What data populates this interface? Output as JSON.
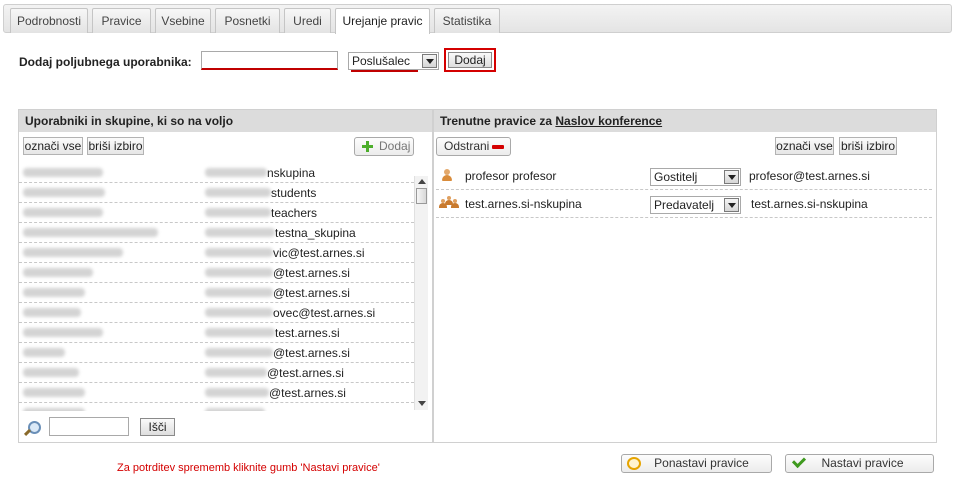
{
  "tabs": [
    "Podrobnosti",
    "Pravice",
    "Vsebine",
    "Posnetki",
    "Uredi",
    "Urejanje pravic",
    "Statistika"
  ],
  "active_tab": "Urejanje pravic",
  "add_user": {
    "label": "Dodaj poljubnega uporabnika:",
    "input_value": "",
    "role_value": "Poslušalec",
    "button_label": "Dodaj"
  },
  "available": {
    "title": "Uporabniki in skupine, ki so na voljo",
    "select_all_label": "označi vse",
    "clear_label": "briši izbiro",
    "add_label": "Dodaj",
    "rows": [
      {
        "tail": "nskupina"
      },
      {
        "tail": "students"
      },
      {
        "tail": "teachers"
      },
      {
        "tail": "testna_skupina"
      },
      {
        "tail": "vic@test.arnes.si"
      },
      {
        "tail": "@test.arnes.si"
      },
      {
        "tail": "@test.arnes.si"
      },
      {
        "tail": "ovec@test.arnes.si"
      },
      {
        "tail": "test.arnes.si"
      },
      {
        "tail": "@test.arnes.si"
      },
      {
        "tail": "@test.arnes.si"
      },
      {
        "tail": "@test.arnes.si"
      },
      {
        "tail": ""
      }
    ],
    "search_value": "",
    "search_button": "Išči"
  },
  "current": {
    "title_prefix": "Trenutne pravice za",
    "title_link": "Naslov konference",
    "remove_label": "Odstrani",
    "select_all_label": "označi vse",
    "clear_label": "briši izbiro",
    "rows": [
      {
        "icon": "person-icon",
        "name": "profesor profesor",
        "role": "Gostitelj",
        "email": "profesor@test.arnes.si"
      },
      {
        "icon": "group-icon",
        "name": "test.arnes.si-nskupina",
        "role": "Predavatelj",
        "email": "test.arnes.si-nskupina"
      }
    ]
  },
  "footer": {
    "note": "Za potrditev sprememb kliknite gumb 'Nastavi pravice'",
    "reset_label": "Ponastavi pravice",
    "apply_label": "Nastavi pravice"
  },
  "colors": {
    "accent_red": "#d40000",
    "panel_header": "#dcdcdc"
  }
}
